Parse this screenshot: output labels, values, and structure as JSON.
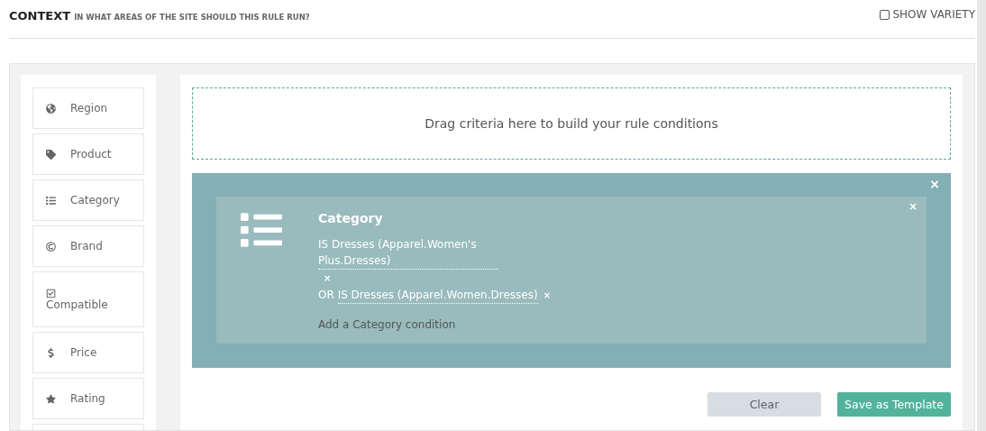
{
  "header": {
    "title": "CONTEXT",
    "subtitle": "IN WHAT AREAS OF THE SITE SHOULD THIS RULE RUN?",
    "show_variety": {
      "label": "SHOW VARIETY",
      "checked": false
    }
  },
  "sidebar": {
    "items": [
      {
        "label": "Region",
        "kind": "row"
      },
      {
        "label": "Product",
        "kind": "row"
      },
      {
        "label": "Category",
        "kind": "row"
      },
      {
        "label": "Brand",
        "kind": "row"
      },
      {
        "label": "Compatible",
        "kind": "stacked"
      },
      {
        "label": "Price",
        "kind": "row"
      },
      {
        "label": "Rating",
        "kind": "row"
      },
      {
        "kind": "blank"
      }
    ]
  },
  "dropzone": {
    "text": "Drag criteria here to build your rule conditions"
  },
  "rule_block": {
    "remove": "×",
    "card": {
      "title": "Category",
      "remove": "×",
      "conditions": [
        {
          "text": "IS Dresses (Apparel.Women's Plus.Dresses)",
          "remove": "×"
        },
        {
          "prefix": "OR",
          "text": "IS Dresses (Apparel.Women.Dresses)",
          "remove": "×"
        }
      ],
      "add_link": "Add a Category condition"
    }
  },
  "buttons": [
    {
      "label": "Clear",
      "kind": "secondary"
    },
    {
      "label": "Save as Template",
      "kind": "primary"
    }
  ]
}
